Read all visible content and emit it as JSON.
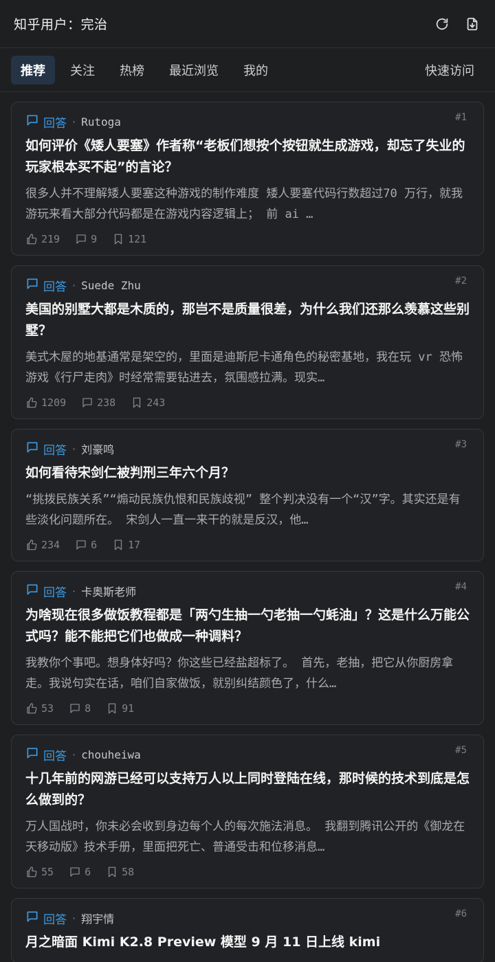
{
  "header": {
    "title": "知乎用户：完治",
    "refresh_icon": "refresh-icon",
    "export_icon": "download-file-icon"
  },
  "tabs": [
    {
      "label": "推荐",
      "active": true
    },
    {
      "label": "关注",
      "active": false
    },
    {
      "label": "热榜",
      "active": false
    },
    {
      "label": "最近浏览",
      "active": false
    },
    {
      "label": "我的",
      "active": false
    }
  ],
  "quick_access": "快速访问",
  "colors": {
    "accent": "#3b9be6",
    "background": "#1e1f21",
    "card": "#212225",
    "active_tab": "#243445"
  },
  "feed": [
    {
      "index": "#1",
      "type": "回答",
      "author": "Rutoga",
      "title": "如何评价《矮人要塞》作者称“老板们想按个按钮就生成游戏，却忘了失业的玩家根本买不起”的言论？",
      "excerpt": "很多人并不理解矮人要塞这种游戏的制作难度 矮人要塞代码行数超过70 万行，就我游玩来看大部分代码都是在游戏内容逻辑上； 前 ai …",
      "likes": "219",
      "comments": "9",
      "favorites": "121"
    },
    {
      "index": "#2",
      "type": "回答",
      "author": "Suede Zhu",
      "title": "美国的别墅大都是木质的，那岂不是质量很差，为什么我们还那么羡慕这些别墅？",
      "excerpt": "美式木屋的地基通常是架空的，里面是迪斯尼卡通角色的秘密基地，我在玩 vr 恐怖游戏《行尸走肉》时经常需要钻进去，氛围感拉满。现实…",
      "likes": "1209",
      "comments": "238",
      "favorites": "243"
    },
    {
      "index": "#3",
      "type": "回答",
      "author": "刘豪鸣",
      "title": "如何看待宋剑仁被判刑三年六个月？",
      "excerpt": "“挑拨民族关系”“煽动民族仇恨和民族歧视” 整个判决没有一个“汉”字。其实还是有些淡化问题所在。 宋剑人一直一来干的就是反汉，他…",
      "likes": "234",
      "comments": "6",
      "favorites": "17"
    },
    {
      "index": "#4",
      "type": "回答",
      "author": "卡奥斯老师",
      "title": "为啥现在很多做饭教程都是「两勺生抽一勺老抽一勺蚝油」？这是什么万能公式吗？能不能把它们也做成一种调料？",
      "excerpt": "我教你个事吧。想身体好吗？你这些已经盐超标了。 首先，老抽，把它从你厨房拿走。我说句实在话，咱们自家做饭，就别纠结颜色了，什么…",
      "likes": "53",
      "comments": "8",
      "favorites": "91"
    },
    {
      "index": "#5",
      "type": "回答",
      "author": "chouheiwa",
      "title": "十几年前的网游已经可以支持万人以上同时登陆在线，那时候的技术到底是怎么做到的？",
      "excerpt": "万人国战时，你未必会收到身边每个人的每次施法消息。 我翻到腾讯公开的《御龙在天移动版》技术手册，里面把死亡、普通受击和位移消息…",
      "likes": "55",
      "comments": "6",
      "favorites": "58"
    },
    {
      "index": "#6",
      "type": "回答",
      "author": "翔宇情",
      "title": "月之暗面 Kimi K2.8 Preview 模型 9 月 11 日上线 kimi",
      "excerpt": "",
      "likes": "",
      "comments": "",
      "favorites": ""
    }
  ]
}
